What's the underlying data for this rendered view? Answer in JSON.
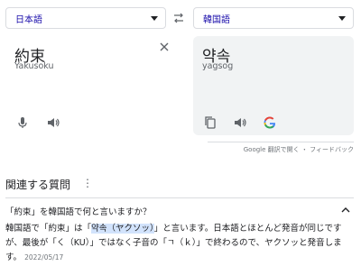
{
  "languages": {
    "source": "日本語",
    "target": "韓国語"
  },
  "source_panel": {
    "text": "約束",
    "transliteration": "Yakusoku"
  },
  "target_panel": {
    "text": "약속",
    "transliteration": "yagsog"
  },
  "footer": {
    "open_in": "Google 翻訳で開く",
    "separator": "・",
    "feedback": "フィードバック"
  },
  "paa": {
    "title": "関連する質問",
    "more": "⋮",
    "question": "「約束」を韓国語で何と言いますか？",
    "answer_pre": "韓国語で「約束」は「",
    "answer_highlight": "약속（ヤクソッ）",
    "answer_post": "」と言います。日本語とほとんど発音が同じですが、最後が「く（KU）」ではなく子音の「ㄱ（ｋ）」で終わるので、ヤクソッと発音します。",
    "date": "2022/05/17"
  },
  "colors": {
    "accent_link": "#1a0dab",
    "target_bg": "#f1f3f4",
    "highlight": "#d2e3fc"
  }
}
